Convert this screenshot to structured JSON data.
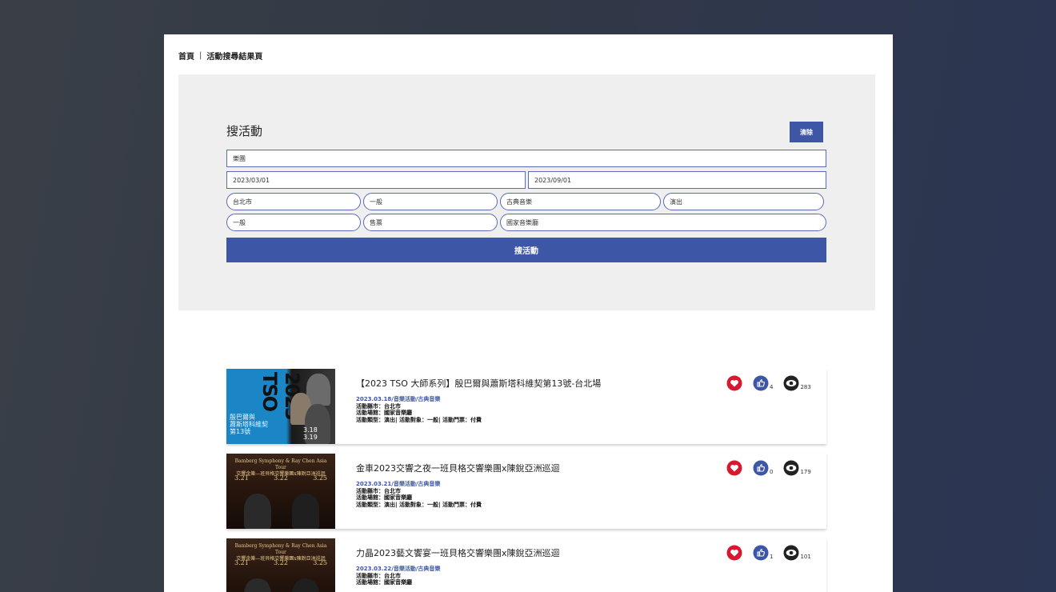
{
  "breadcrumb": {
    "home": "首頁",
    "separator": "|",
    "current": "活動搜尋結果頁"
  },
  "search": {
    "title": "搜活動",
    "clear_label": "清除",
    "keyword": "樂團",
    "date_start": "2023/03/01",
    "date_end": "2023/09/01",
    "filters_row1": [
      "台北市",
      "一般",
      "古典音樂",
      "演出"
    ],
    "filters_row2": [
      "一般",
      "售票",
      "國家音樂廳"
    ],
    "submit_label": "搜活動"
  },
  "colors": {
    "accent": "#3d56a6",
    "heart": "#d8182f",
    "like": "#3d56a6",
    "eye": "#222222"
  },
  "results": [
    {
      "title": "【2023 TSO 大師系列】殷巴爾與蕭斯塔科維契第13號-台北場",
      "tag": "2023.03.18/音樂活動/古典音樂",
      "city": "活動縣市：台北市",
      "venue": "活動場館：國家音樂廳",
      "type": "活動類型：演出| 活動對象：一般| 活動門票：付費",
      "likes": "4",
      "views": "283",
      "thumb": {
        "big": "2023 TSO",
        "text": [
          "殷巴爾與",
          "蕭斯塔科維契",
          "第13號"
        ],
        "dates": [
          "3.18",
          "3.19"
        ]
      }
    },
    {
      "title": "金車2023交響之夜一班貝格交響樂團x陳銳亞洲巡迴",
      "tag": "2023.03.21/音樂活動/古典音樂",
      "city": "活動縣市：台北市",
      "venue": "活動場館：國家音樂廳",
      "type": "活動類型：演出| 活動對象：一般| 活動門票：付費",
      "likes": "0",
      "views": "179",
      "thumb": {
        "title_en": "Bamberg Symphony & Ray Chen Asia Tour",
        "title_zh": "交響金樂—班貝格交響樂團x陳銳亞洲巡迴",
        "dates": [
          "3.21",
          "3.22",
          "3.25"
        ]
      }
    },
    {
      "title": "力晶2023藝文饗宴一班貝格交響樂團x陳銳亞洲巡迴",
      "tag": "2023.03.22/音樂活動/古典音樂",
      "city": "活動縣市：台北市",
      "venue": "活動場館：國家音樂廳",
      "type": "",
      "likes": "1",
      "views": "101",
      "thumb": {
        "title_en": "Bamberg Symphony & Ray Chen Asia Tour",
        "title_zh": "交響金樂—班貝格交響樂團x陳銳亞洲巡迴",
        "dates": [
          "3.21",
          "3.22",
          "3.25"
        ]
      }
    }
  ]
}
